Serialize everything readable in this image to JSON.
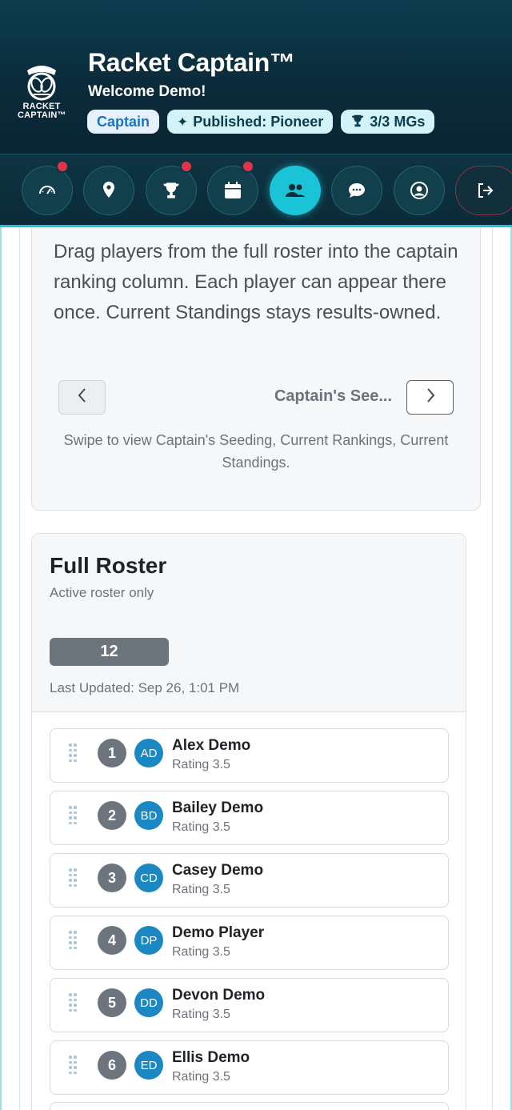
{
  "header": {
    "logo_text_line1": "RACKET",
    "logo_text_line2": "CAPTAIN™",
    "app_title": "Racket Captain™",
    "welcome": "Welcome Demo!",
    "badges": {
      "role": "Captain",
      "published": "Published: Pioneer",
      "mgs": "3/3 MGs"
    }
  },
  "nav": {
    "items": [
      {
        "icon": "dashboard-icon",
        "notification": true
      },
      {
        "icon": "location-pin-icon",
        "notification": false
      },
      {
        "icon": "trophy-icon",
        "notification": true
      },
      {
        "icon": "calendar-icon",
        "notification": true
      },
      {
        "icon": "roster-users-icon",
        "notification": false,
        "active": true
      },
      {
        "icon": "chat-icon",
        "notification": false
      },
      {
        "icon": "profile-icon",
        "notification": false
      },
      {
        "icon": "logout-icon",
        "notification": false
      }
    ]
  },
  "seeding": {
    "instructions": "Drag players from the full roster into the captain ranking column. Each player can appear there once. Current Standings stays results-owned.",
    "carousel_label": "Captain's See...",
    "swipe_hint": "Swipe to view Captain's Seeding, Current Rankings, Current Standings."
  },
  "roster": {
    "title": "Full Roster",
    "subtitle": "Active roster only",
    "count": "12",
    "last_updated": "Last Updated: Sep 26, 1:01 PM",
    "players": [
      {
        "rank": "1",
        "initials": "AD",
        "name": "Alex Demo",
        "rating": "Rating 3.5"
      },
      {
        "rank": "2",
        "initials": "BD",
        "name": "Bailey Demo",
        "rating": "Rating 3.5"
      },
      {
        "rank": "3",
        "initials": "CD",
        "name": "Casey Demo",
        "rating": "Rating 3.5"
      },
      {
        "rank": "4",
        "initials": "DP",
        "name": "Demo Player",
        "rating": "Rating 3.5"
      },
      {
        "rank": "5",
        "initials": "DD",
        "name": "Devon Demo",
        "rating": "Rating 3.5"
      },
      {
        "rank": "6",
        "initials": "ED",
        "name": "Ellis Demo",
        "rating": "Rating 3.5"
      }
    ]
  },
  "colors": {
    "header_bg": "#0b2b3b",
    "accent": "#1bc3d6",
    "notification": "#e0344a",
    "avatar": "#1b87c3",
    "rank_badge": "#6c757d"
  }
}
